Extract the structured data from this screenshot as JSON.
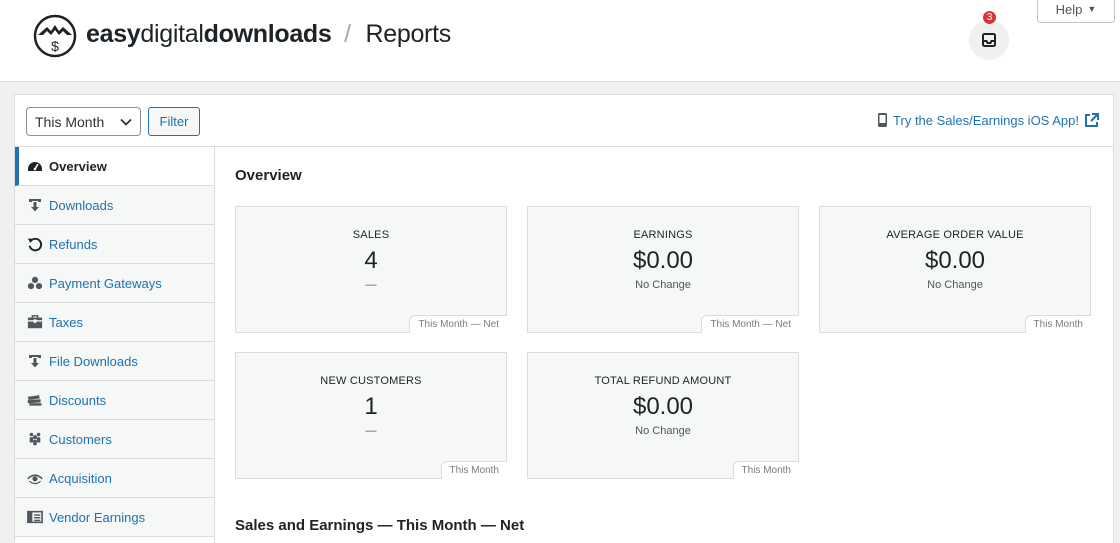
{
  "header": {
    "brand_bold1": "easy",
    "brand_light": "digital",
    "brand_bold2": "downloads",
    "separator": "/",
    "page_title": "Reports",
    "notification_count": "3",
    "help_label": "Help",
    "icons": {
      "logo": "edd-logo-icon",
      "inbox": "inbox-icon"
    }
  },
  "toolbar": {
    "range_value": "This Month",
    "filter_label": "Filter",
    "ios_link": "Try the Sales/Earnings iOS App!"
  },
  "sidebar": {
    "items": [
      {
        "label": "Overview",
        "icon": "dashboard-icon"
      },
      {
        "label": "Downloads",
        "icon": "download-icon"
      },
      {
        "label": "Refunds",
        "icon": "refund-icon"
      },
      {
        "label": "Payment Gateways",
        "icon": "groups-icon"
      },
      {
        "label": "Taxes",
        "icon": "store-icon"
      },
      {
        "label": "File Downloads",
        "icon": "download-icon"
      },
      {
        "label": "Discounts",
        "icon": "tickets-icon"
      },
      {
        "label": "Customers",
        "icon": "customers-icon"
      },
      {
        "label": "Acquisition",
        "icon": "visibility-icon"
      },
      {
        "label": "Vendor Earnings",
        "icon": "vendor-icon"
      }
    ]
  },
  "content": {
    "overview_title": "Overview",
    "sales_title": "Sales and Earnings — This Month — Net",
    "tiles": [
      {
        "label": "SALES",
        "value": "4",
        "change": "—",
        "period": "This Month — Net"
      },
      {
        "label": "EARNINGS",
        "value": "$0.00",
        "change": "No Change",
        "period": "This Month — Net"
      },
      {
        "label": "AVERAGE ORDER VALUE",
        "value": "$0.00",
        "change": "No Change",
        "period": "This Month"
      },
      {
        "label": "NEW CUSTOMERS",
        "value": "1",
        "change": "—",
        "period": "This Month"
      },
      {
        "label": "TOTAL REFUND AMOUNT",
        "value": "$0.00",
        "change": "No Change",
        "period": "This Month"
      }
    ]
  },
  "colors": {
    "accent": "#2271b1",
    "badge": "#d63638",
    "tile_bg": "#f6f7f7",
    "border": "#dcdcde"
  }
}
